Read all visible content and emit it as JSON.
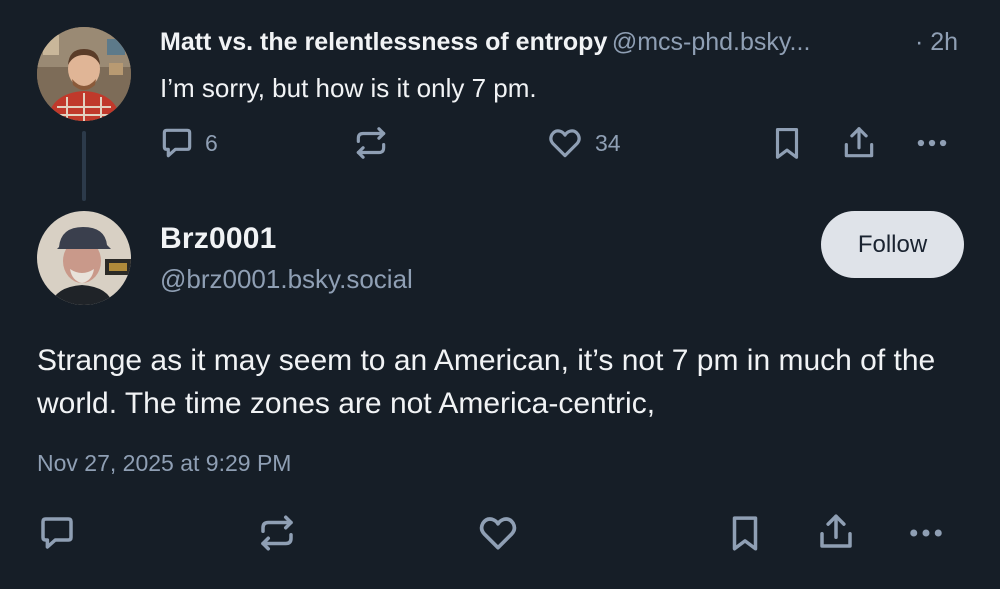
{
  "parent_post": {
    "display_name": "Matt vs. the relentlessness of entropy",
    "handle": "@mcs-phd.bsky...",
    "time": "· 2h",
    "text": "I’m sorry, but how is it only 7 pm.",
    "reply_count": "6",
    "like_count": "34",
    "avatar_icon": "avatar-photo"
  },
  "main_post": {
    "display_name": "Brz0001",
    "handle": "@brz0001.bsky.social",
    "follow_label": "Follow",
    "text": "Strange as it may seem to an American, it’s not 7 pm in much of the world.  The time zones are not America-centric,",
    "timestamp": "Nov 27, 2025 at 9:29 PM",
    "avatar_icon": "avatar-photo"
  },
  "icons": [
    "reply-icon",
    "repost-icon",
    "like-icon",
    "bookmark-icon",
    "share-icon",
    "more-icon"
  ],
  "colors": {
    "background": "#161e27",
    "text": "#f1f3f5",
    "muted": "#8f9fb4",
    "follow_button_bg": "#dfe3e9"
  }
}
